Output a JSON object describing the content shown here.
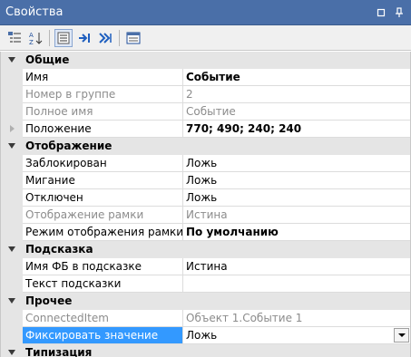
{
  "window": {
    "title": "Свойства"
  },
  "categories": {
    "general": "Общие",
    "display": "Отображение",
    "hint": "Подсказка",
    "other": "Прочее",
    "typing": "Типизация"
  },
  "props": {
    "name": {
      "label": "Имя",
      "value": "Событие"
    },
    "group_no": {
      "label": "Номер в группе",
      "value": "2"
    },
    "full_name": {
      "label": "Полное имя",
      "value": "Событие"
    },
    "position": {
      "label": "Положение",
      "value": "770; 490; 240; 240"
    },
    "locked": {
      "label": "Заблокирован",
      "value": "Ложь"
    },
    "blink": {
      "label": "Мигание",
      "value": "Ложь"
    },
    "disabled": {
      "label": "Отключен",
      "value": "Ложь"
    },
    "frame_display": {
      "label": "Отображение рамки",
      "value": "Истина"
    },
    "frame_mode": {
      "label": "Режим отображения рамки",
      "value": "По умолчанию"
    },
    "fb_name_hint": {
      "label": "Имя ФБ в подсказке",
      "value": "Истина"
    },
    "hint_text": {
      "label": "Текст подсказки",
      "value": ""
    },
    "connected_item": {
      "label": "ConnectedItem",
      "value": "Объект 1.Событие 1"
    },
    "fix_value": {
      "label": "Фиксировать значение",
      "value": "Ложь"
    }
  }
}
